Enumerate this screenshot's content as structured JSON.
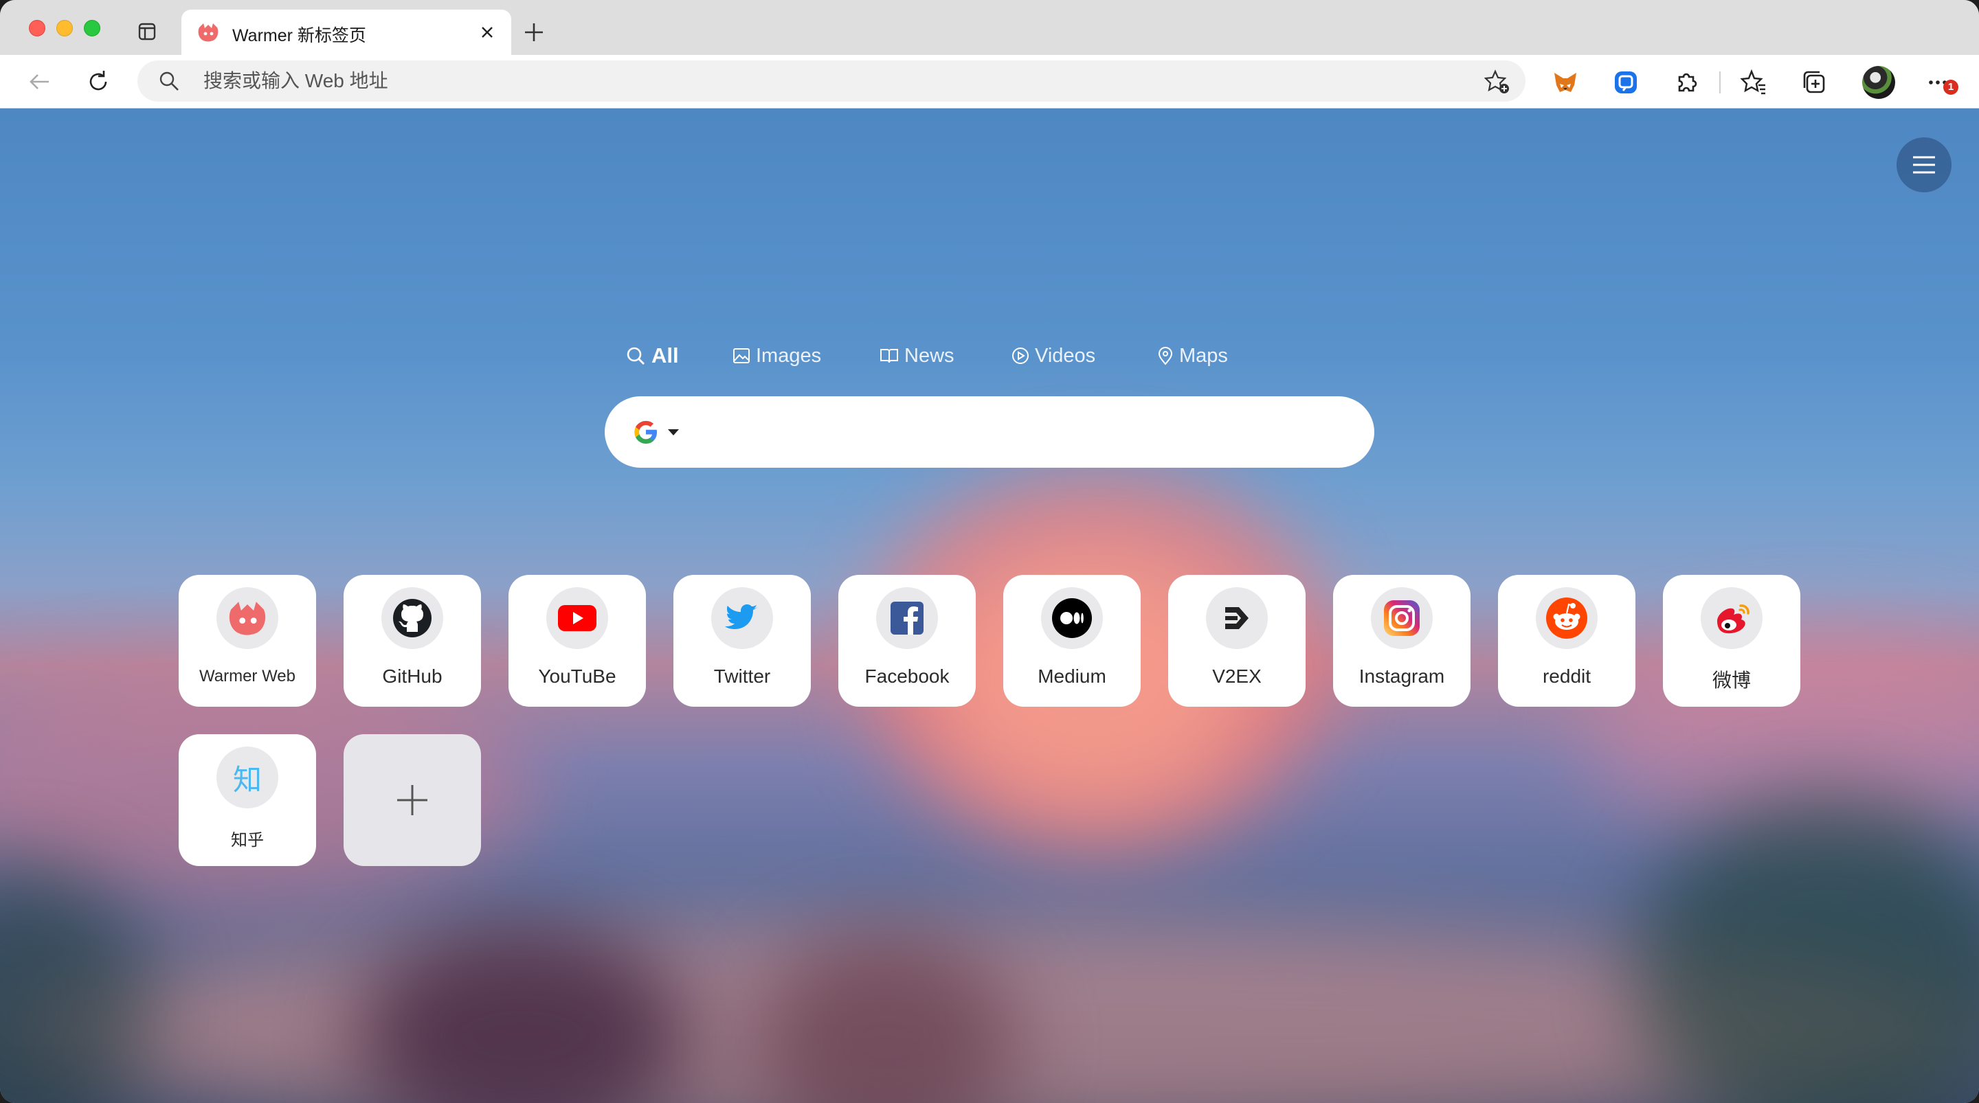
{
  "tab": {
    "title": "Warmer 新标签页"
  },
  "omnibox": {
    "placeholder": "搜索或输入 Web 地址"
  },
  "notifications": {
    "badge": "1"
  },
  "search": {
    "tabs": [
      {
        "label": "All",
        "icon": "search-icon",
        "active": true
      },
      {
        "label": "Images",
        "icon": "image-icon",
        "active": false
      },
      {
        "label": "News",
        "icon": "book-icon",
        "active": false
      },
      {
        "label": "Videos",
        "icon": "play-icon",
        "active": false
      },
      {
        "label": "Maps",
        "icon": "pin-icon",
        "active": false
      }
    ],
    "engine": "google-logo-icon"
  },
  "shortcuts": [
    {
      "label": "Warmer Web",
      "icon": "warmer-logo-icon"
    },
    {
      "label": "GitHub",
      "icon": "github-icon"
    },
    {
      "label": "YouTuBe",
      "icon": "youtube-icon"
    },
    {
      "label": "Twitter",
      "icon": "twitter-icon"
    },
    {
      "label": "Facebook",
      "icon": "facebook-icon"
    },
    {
      "label": "Medium",
      "icon": "medium-icon"
    },
    {
      "label": "V2EX",
      "icon": "v2ex-icon"
    },
    {
      "label": "Instagram",
      "icon": "instagram-icon"
    },
    {
      "label": "reddit",
      "icon": "reddit-icon"
    },
    {
      "label": "微博",
      "icon": "weibo-icon"
    },
    {
      "label": "知乎",
      "icon": "zhihu-icon",
      "glyph": "知"
    }
  ],
  "colors": {
    "youtube": "#ff0000",
    "twitter": "#1d9bf0",
    "facebook": "#3b5998",
    "reddit": "#ff4500",
    "weibo": "#e6162d",
    "zhihu": "#4db8f0",
    "warmer": "#ef6b6b"
  }
}
